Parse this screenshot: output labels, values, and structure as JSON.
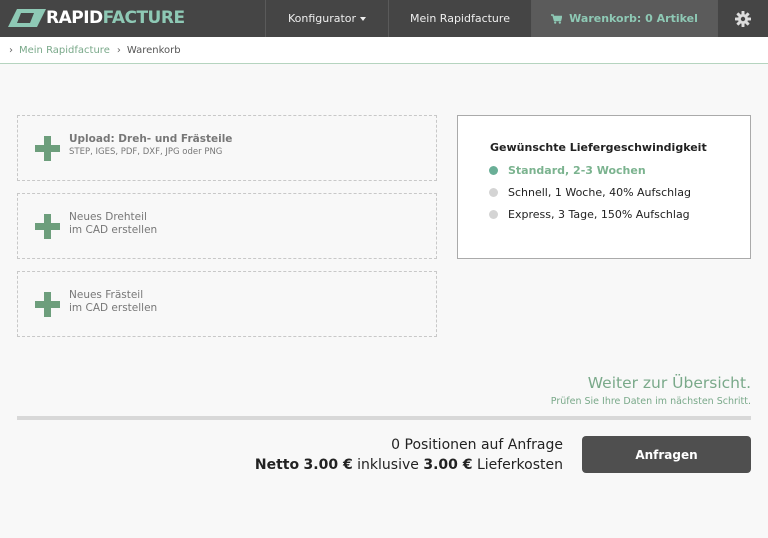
{
  "brand": {
    "logo_part1": "RAPID",
    "logo_part2": "FACTURE",
    "logo_icon": "parallelogram-logo"
  },
  "nav": {
    "konfigurator": "Konfigurator",
    "mein": "Mein Rapidfacture",
    "cart": "Warenkorb: 0 Artikel",
    "cart_icon": "cart-icon",
    "settings_icon": "gear-icon"
  },
  "breadcrumb": {
    "link": "Mein Rapidfacture",
    "current": "Warenkorb"
  },
  "uploads": [
    {
      "line1": "Upload: Dreh- und Frästeile",
      "line2": "STEP, IGES, PDF, DXF, JPG oder PNG"
    },
    {
      "line1": "Neues Drehteil",
      "line2": "im CAD erstellen"
    },
    {
      "line1": "Neues Frästeil",
      "line2": "im CAD erstellen"
    }
  ],
  "speed": {
    "title": "Gewünschte Liefergeschwindigkeit",
    "options": [
      {
        "label": "Standard, 2-3 Wochen",
        "selected": true
      },
      {
        "label": "Schnell, 1 Woche, 40% Aufschlag",
        "selected": false
      },
      {
        "label": "Express, 3 Tage, 150% Aufschlag",
        "selected": false
      }
    ]
  },
  "summary": {
    "next_title": "Weiter zur Übersicht.",
    "next_sub": "Prüfen Sie Ihre Daten im nächsten Schritt.",
    "positions": "0 Positionen auf Anfrage",
    "netto_label": "Netto",
    "netto_value": "3.00 €",
    "inkl": "inklusive",
    "delivery_value": "3.00 €",
    "delivery_label": "Lieferkosten",
    "button": "Anfragen"
  },
  "colors": {
    "accent": "#7aa98a",
    "topbar": "#454545",
    "button": "#4f4f4f"
  }
}
